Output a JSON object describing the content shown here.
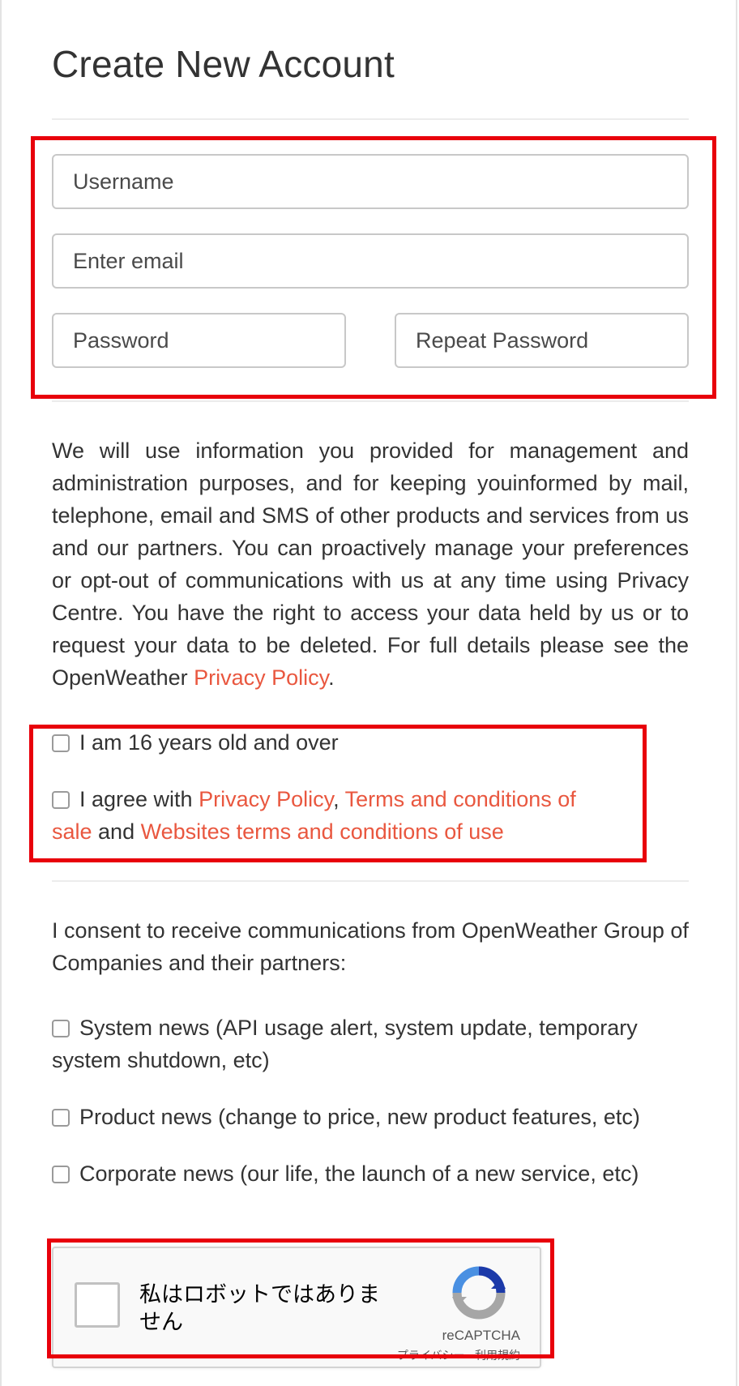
{
  "form": {
    "title": "Create New Account",
    "username_placeholder": "Username",
    "email_placeholder": "Enter email",
    "password_placeholder": "Password",
    "repeat_password_placeholder": "Repeat Password"
  },
  "notice": {
    "text": "We will use information you provided for management and administration purposes, and for keeping youinformed by mail, telephone, email and SMS of other products and services from us and our partners. You can proactively manage your preferences or opt-out of communications with us at any time using Privacy Centre. You have the right to access your data held by us or to request your data to be deleted. For full details please see the OpenWeather ",
    "link": "Privacy Policy",
    "end": "."
  },
  "agreements": {
    "age_label": "I am 16 years old and over",
    "agree_prefix": "I agree with ",
    "privacy_link": "Privacy Policy",
    "comma": ", ",
    "terms_sale_link": "Terms and conditions of sale",
    "and_text": " and ",
    "terms_use_link": "Websites terms and conditions of use"
  },
  "consent": {
    "intro": "I consent to receive communications from OpenWeather Group of Companies and their partners:",
    "options": [
      "System news (API usage alert, system update, temporary system shutdown, etc)",
      "Product news (change to price, new product features, etc)",
      "Corporate news (our life, the launch of a new service, etc)"
    ]
  },
  "captcha": {
    "label": "私はロボットではありません",
    "brand": "reCAPTCHA",
    "links": "プライバシー - 利用規約",
    "icon": "recaptcha-logo-icon"
  },
  "colors": {
    "link": "#e9573f",
    "highlight": "#e8000b",
    "text": "#333333"
  }
}
